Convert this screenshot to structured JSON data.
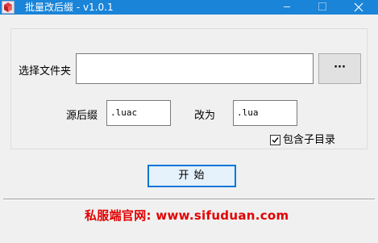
{
  "window": {
    "title": "批量改后缀  - v1.0.1",
    "icon": "app-cube-icon",
    "controls": [
      "minimize",
      "maximize",
      "close"
    ],
    "title_bar_color": "#1a84d8"
  },
  "form": {
    "folder_label": "选择文件夹",
    "folder_value": "",
    "browse_label": "···",
    "source_ext_label": "源后缀",
    "source_ext_value": ".luac",
    "target_ext_label": "改为",
    "target_ext_value": ".lua",
    "include_subdirs_label": "包含子目录",
    "include_subdirs_checked": true,
    "start_label": "开  始"
  },
  "footer": {
    "promo_text": "私服端官网:  www.sifuduan.com",
    "promo_color": "#e30000"
  }
}
